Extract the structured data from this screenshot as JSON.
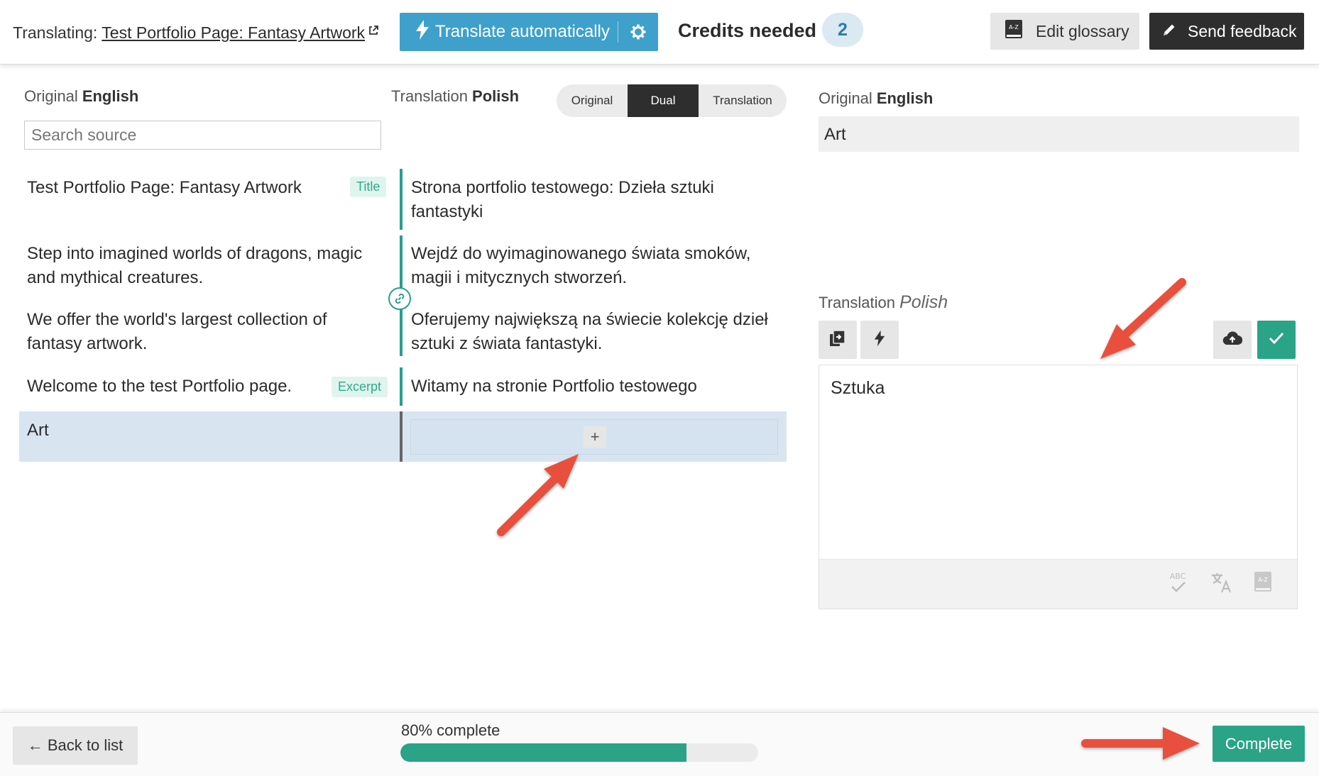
{
  "header": {
    "translating_label": "Translating:",
    "page_title": "Test Portfolio Page: Fantasy Artwork",
    "translate_auto_label": "Translate automatically",
    "credits_label": "Credits needed",
    "credits_value": "2",
    "edit_glossary_label": "Edit glossary",
    "send_feedback_label": "Send feedback"
  },
  "left": {
    "original_label": "Original",
    "original_language": "English",
    "translation_label": "Translation",
    "translation_language": "Polish",
    "search_placeholder": "Search source",
    "view_toggle": {
      "options": [
        "Original",
        "Dual",
        "Translation"
      ],
      "selected": "Dual"
    }
  },
  "rows": [
    {
      "source": "Test Portfolio Page: Fantasy Artwork",
      "tag": "Title",
      "translation": "Strona portfolio testowego: Dzieła sztuki fantastyki"
    },
    {
      "source": "Step into imagined worlds of dragons, magic and mythical creatures.",
      "tag": "",
      "translation": "Wejdź do wyimaginowanego świata smoków, magii i mitycznych stworzeń."
    },
    {
      "source": "We offer the world's largest collection of fantasy artwork.",
      "tag": "",
      "translation": "Oferujemy największą na świecie kolekcję dzieł sztuki z świata fantastyki."
    },
    {
      "source": "Welcome to the test Portfolio page.",
      "tag": "Excerpt",
      "translation": "Witamy na stronie Portfolio testowego"
    },
    {
      "source": "Art",
      "tag": "",
      "translation": ""
    }
  ],
  "add_translation_symbol": "+",
  "right": {
    "original_label": "Original",
    "original_language": "English",
    "original_text": "Art",
    "translation_label": "Translation",
    "translation_language": "Polish",
    "translation_text": "Sztuka",
    "spellcheck_abbr": "ABC",
    "glossary_abbr": "A-Z"
  },
  "footer": {
    "back_label": "← Back to list",
    "progress_label": "80% complete",
    "progress_percent": 80,
    "complete_label": "Complete"
  },
  "colors": {
    "accent_blue": "#3fa0cc",
    "accent_green": "#2aa387",
    "annotation_arrow": "#e8503e"
  }
}
